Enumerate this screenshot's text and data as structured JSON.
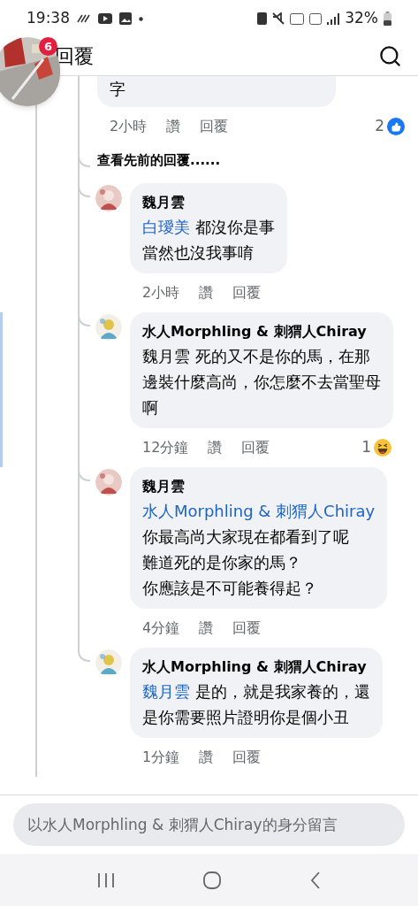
{
  "status_bar": {
    "time": "19:38",
    "battery": "32%"
  },
  "chat_head": {
    "badge": "6"
  },
  "header": {
    "title": "回覆"
  },
  "thread": [
    {
      "kind": "parent",
      "lines": [
        {
          "text": "字"
        }
      ],
      "meta": {
        "time": "2小時",
        "like": "讚",
        "reply": "回覆"
      },
      "reaction": {
        "kind": "like",
        "count": "2"
      }
    },
    {
      "kind": "more",
      "text": "查看先前的回覆......"
    },
    {
      "kind": "reply",
      "highlighted": false,
      "name": "魏月雲",
      "lines": [
        {
          "mention": "白璦美",
          "text": "都沒你是事"
        },
        {
          "text": "當然也沒我事唷"
        }
      ],
      "meta": {
        "time": "2小時",
        "like": "讚",
        "reply": "回覆"
      }
    },
    {
      "kind": "reply",
      "highlighted": true,
      "name": "水人Morphling & 刺猬人Chiray",
      "lines": [
        {
          "text": "魏月雲 死的又不是你的馬，在那"
        },
        {
          "text": "邊裝什麼高尚，你怎麼不去當聖母"
        },
        {
          "text": "啊"
        }
      ],
      "meta": {
        "time": "12分鐘",
        "like": "讚",
        "reply": "回覆"
      },
      "reaction": {
        "kind": "haha",
        "count": "1"
      }
    },
    {
      "kind": "reply",
      "highlighted": false,
      "name": "魏月雲",
      "lines": [
        {
          "mention": "水人Morphling & 刺猬人Chiray"
        },
        {
          "text": "你最高尚大家現在都看到了呢"
        },
        {
          "text": "難道死的是你家的馬？"
        },
        {
          "text": "你應該是不可能養得起？"
        }
      ],
      "meta": {
        "time": "4分鐘",
        "like": "讚",
        "reply": "回覆"
      }
    },
    {
      "kind": "reply",
      "highlighted": false,
      "name": "水人Morphling & 刺猬人Chiray",
      "lines": [
        {
          "mention": "魏月雲",
          "text": "是的，就是我家養的，還"
        },
        {
          "text": "是你需要照片證明你是個小丑"
        }
      ],
      "meta": {
        "time": "1分鐘",
        "like": "讚",
        "reply": "回覆"
      }
    }
  ],
  "composer": {
    "placeholder": "以水人Morphling & 刺猬人Chiray的身分留言"
  }
}
